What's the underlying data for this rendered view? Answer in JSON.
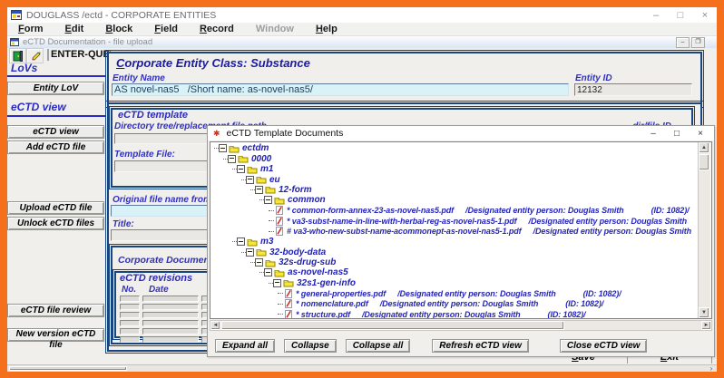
{
  "colors": {
    "frame": "#f4701d",
    "panel_border": "#17457f",
    "label_blue": "#3030c0",
    "tree_text": "#2222b4",
    "input_cyan": "#d9f2f8"
  },
  "window": {
    "title": "DOUGLASS /ectd - CORPORATE ENTITIES"
  },
  "window_controls": [
    "–",
    "□",
    "×"
  ],
  "menu": {
    "items": [
      {
        "label": "Form"
      },
      {
        "label": "Edit"
      },
      {
        "label": "Block"
      },
      {
        "label": "Field"
      },
      {
        "label": "Record"
      },
      {
        "label": "Window",
        "disabled": true
      },
      {
        "label": "Help"
      }
    ]
  },
  "mdi": {
    "title": "eCTD Documentation - file upload",
    "mode_indicator": "ENTER-QUERY",
    "buttons": [
      "–",
      "❐"
    ]
  },
  "toolbar": {
    "icons": [
      "exit-door-icon",
      "pencil-icon"
    ]
  },
  "sidebar": {
    "heading_lovs": "LoVs",
    "btn_entity_lov": "Entity LoV",
    "heading_ectd_view": "eCTD view",
    "btn_ectd_view": "eCTD view",
    "btn_add_ectd_file": "Add eCTD file",
    "btn_upload_ectd_file": "Upload eCTD file",
    "btn_unlock_ectd_files": "Unlock eCTD files",
    "btn_ectd_file_review": "eCTD file review",
    "btn_new_version": "New version eCTD file"
  },
  "entity_panel": {
    "title": "Corporate Entity Class: Substance",
    "entity_name_label": "Entity Name",
    "entity_name_value": "AS novel-nas5   /Short name: as-novel-nas5/",
    "entity_id_label": "Entity ID",
    "entity_id_value": "12132"
  },
  "template_panel": {
    "title": "eCTD template",
    "dir_label": "Directory tree/replacement file path",
    "dirfile_id_label": "dir/file ID",
    "template_file_label": "Template File:",
    "orig_name_label": "Original file name from local d",
    "title_label": "Title:",
    "corp_doc_label": "Corporate Documentation Clou",
    "revisions": {
      "title": "eCTD revisions",
      "col_no": "No.",
      "col_date": "Date",
      "rows": 6
    }
  },
  "dialog": {
    "title": "eCTD Template Documents",
    "controls": [
      "–",
      "□",
      "×"
    ],
    "tree": [
      {
        "type": "folder",
        "depth": 0,
        "label": "ectdm"
      },
      {
        "type": "folder",
        "depth": 1,
        "label": "0000"
      },
      {
        "type": "folder",
        "depth": 2,
        "label": "m1"
      },
      {
        "type": "folder",
        "depth": 3,
        "label": "eu"
      },
      {
        "type": "folder",
        "depth": 4,
        "label": "12-form"
      },
      {
        "type": "folder",
        "depth": 5,
        "label": "common"
      },
      {
        "type": "file",
        "depth": 6,
        "prefix": "*",
        "name": "common-form-annex-23-as-novel-nas5.pdf",
        "person": "/Designated entity person: Douglas Smith",
        "id": "(ID: 1082)/"
      },
      {
        "type": "file",
        "depth": 6,
        "prefix": "*",
        "name": "va3-subst-name-in-line-with-herbal-reg-as-novel-nas5-1.pdf",
        "person": "/Designated entity person: Douglas Smith",
        "id": ""
      },
      {
        "type": "file",
        "depth": 6,
        "prefix": "#",
        "name": "va3-who-new-subst-name-acommonept-as-novel-nas5-1.pdf",
        "person": "/Designated entity person: Douglas Smith",
        "id": ""
      },
      {
        "type": "folder",
        "depth": 2,
        "label": "m3"
      },
      {
        "type": "folder",
        "depth": 3,
        "label": "32-body-data"
      },
      {
        "type": "folder",
        "depth": 4,
        "label": "32s-drug-sub"
      },
      {
        "type": "folder",
        "depth": 5,
        "label": "as-novel-nas5"
      },
      {
        "type": "folder",
        "depth": 6,
        "label": "32s1-gen-info"
      },
      {
        "type": "file",
        "depth": 7,
        "prefix": "*",
        "name": "general-properties.pdf",
        "person": "/Designated entity person: Douglas Smith",
        "id": "(ID: 1082)/"
      },
      {
        "type": "file",
        "depth": 7,
        "prefix": "*",
        "name": "nomenclature.pdf",
        "person": "/Designated entity person: Douglas Smith",
        "id": "(ID: 1082)/"
      },
      {
        "type": "file",
        "depth": 7,
        "prefix": "*",
        "name": "structure.pdf",
        "person": "/Designated entity person: Douglas Smith",
        "id": "(ID: 1082)/"
      }
    ],
    "buttons": [
      "Expand all",
      "Collapse",
      "Collapse all",
      "Refresh eCTD view",
      "Close eCTD view"
    ]
  },
  "scroll_icons": {
    "up": "▲",
    "down": "▼",
    "right_small": "›"
  },
  "footer": {
    "save": "Save",
    "exit": "Exit"
  }
}
